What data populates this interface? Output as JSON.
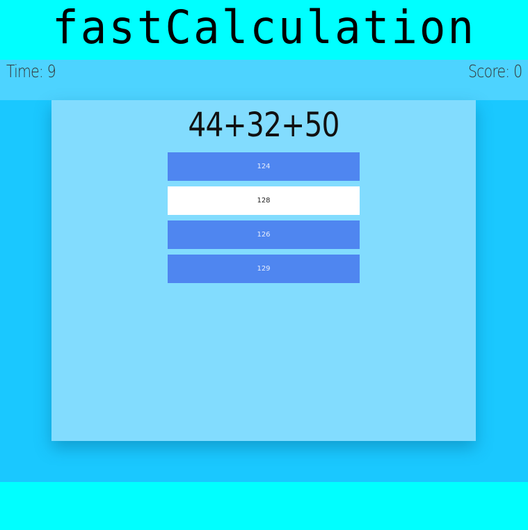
{
  "app": {
    "title": "fastCalculation"
  },
  "status": {
    "time_text": "Time: 9",
    "score_text": "Score: 0"
  },
  "question": {
    "expression": "44+32+50"
  },
  "answers": [
    {
      "label": "124",
      "style": "blue"
    },
    {
      "label": "128",
      "style": "white"
    },
    {
      "label": "126",
      "style": "blue"
    },
    {
      "label": "129",
      "style": "blue"
    }
  ],
  "colors": {
    "page_bg": "#00ffff",
    "status_bar": "#4dd3ff",
    "arena": "#1ac8ff",
    "card": "#82dcfe",
    "answer_blue": "#4f86f0",
    "answer_white": "#ffffff"
  }
}
